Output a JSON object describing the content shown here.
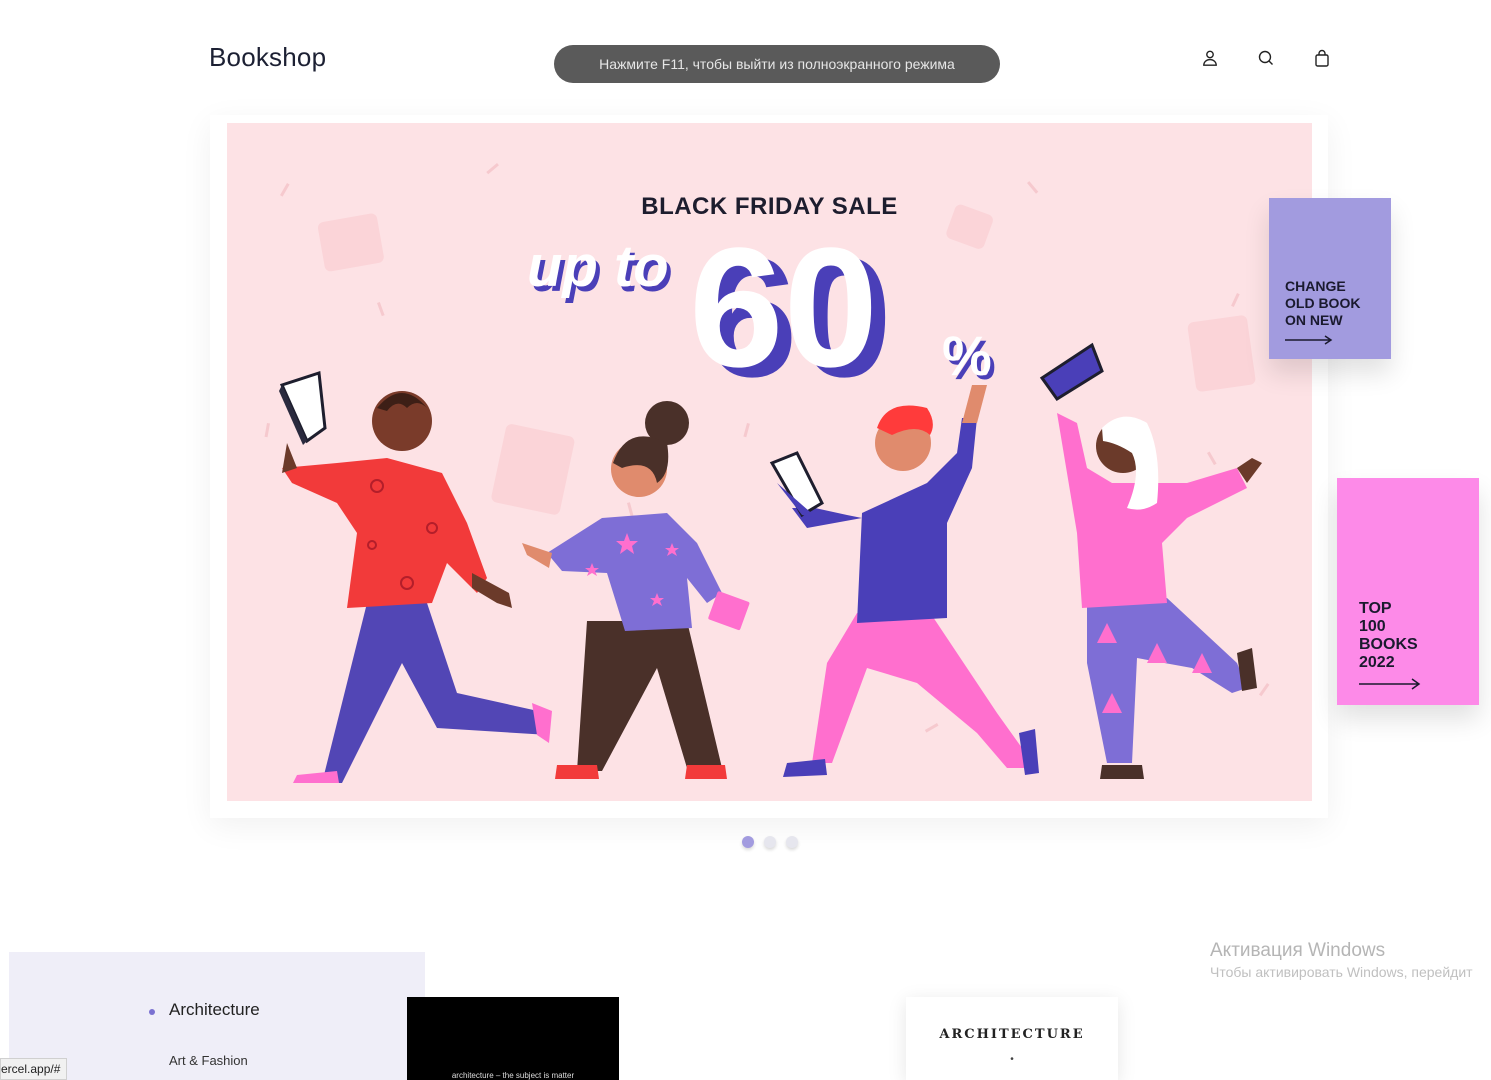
{
  "header": {
    "logo": "Bookshop",
    "icons": [
      "user-icon",
      "search-icon",
      "bag-icon"
    ]
  },
  "fullscreen_toast": "Нажмите F11, чтобы выйти из полноэкранного режима",
  "hero": {
    "title": "BLACK FRIDAY SALE",
    "up_to": "up to",
    "discount": "60",
    "percent": "%",
    "colors": {
      "background": "#fde2e5",
      "accent": "#4a3fb8"
    }
  },
  "side_cards": {
    "change": {
      "lines": [
        "CHANGE",
        "OLD BOOK",
        "ON NEW"
      ],
      "color": "#a29bdf"
    },
    "top": {
      "lines": [
        "TOP",
        "100",
        "BOOKS",
        "2022"
      ],
      "color": "#fd8ae8"
    }
  },
  "carousel": {
    "slides": 3,
    "active": 1
  },
  "windows_watermark": {
    "line1": "Активация Windows",
    "line2": "Чтобы активировать Windows, перейдит"
  },
  "categories": {
    "active": "Architecture",
    "next": "Art & Fashion"
  },
  "books": {
    "black_caption": "architecture – the subject is matter",
    "white_title": "ARCHITECTURE",
    "white_mark": "•"
  },
  "status_bar": "ercel.app/#"
}
